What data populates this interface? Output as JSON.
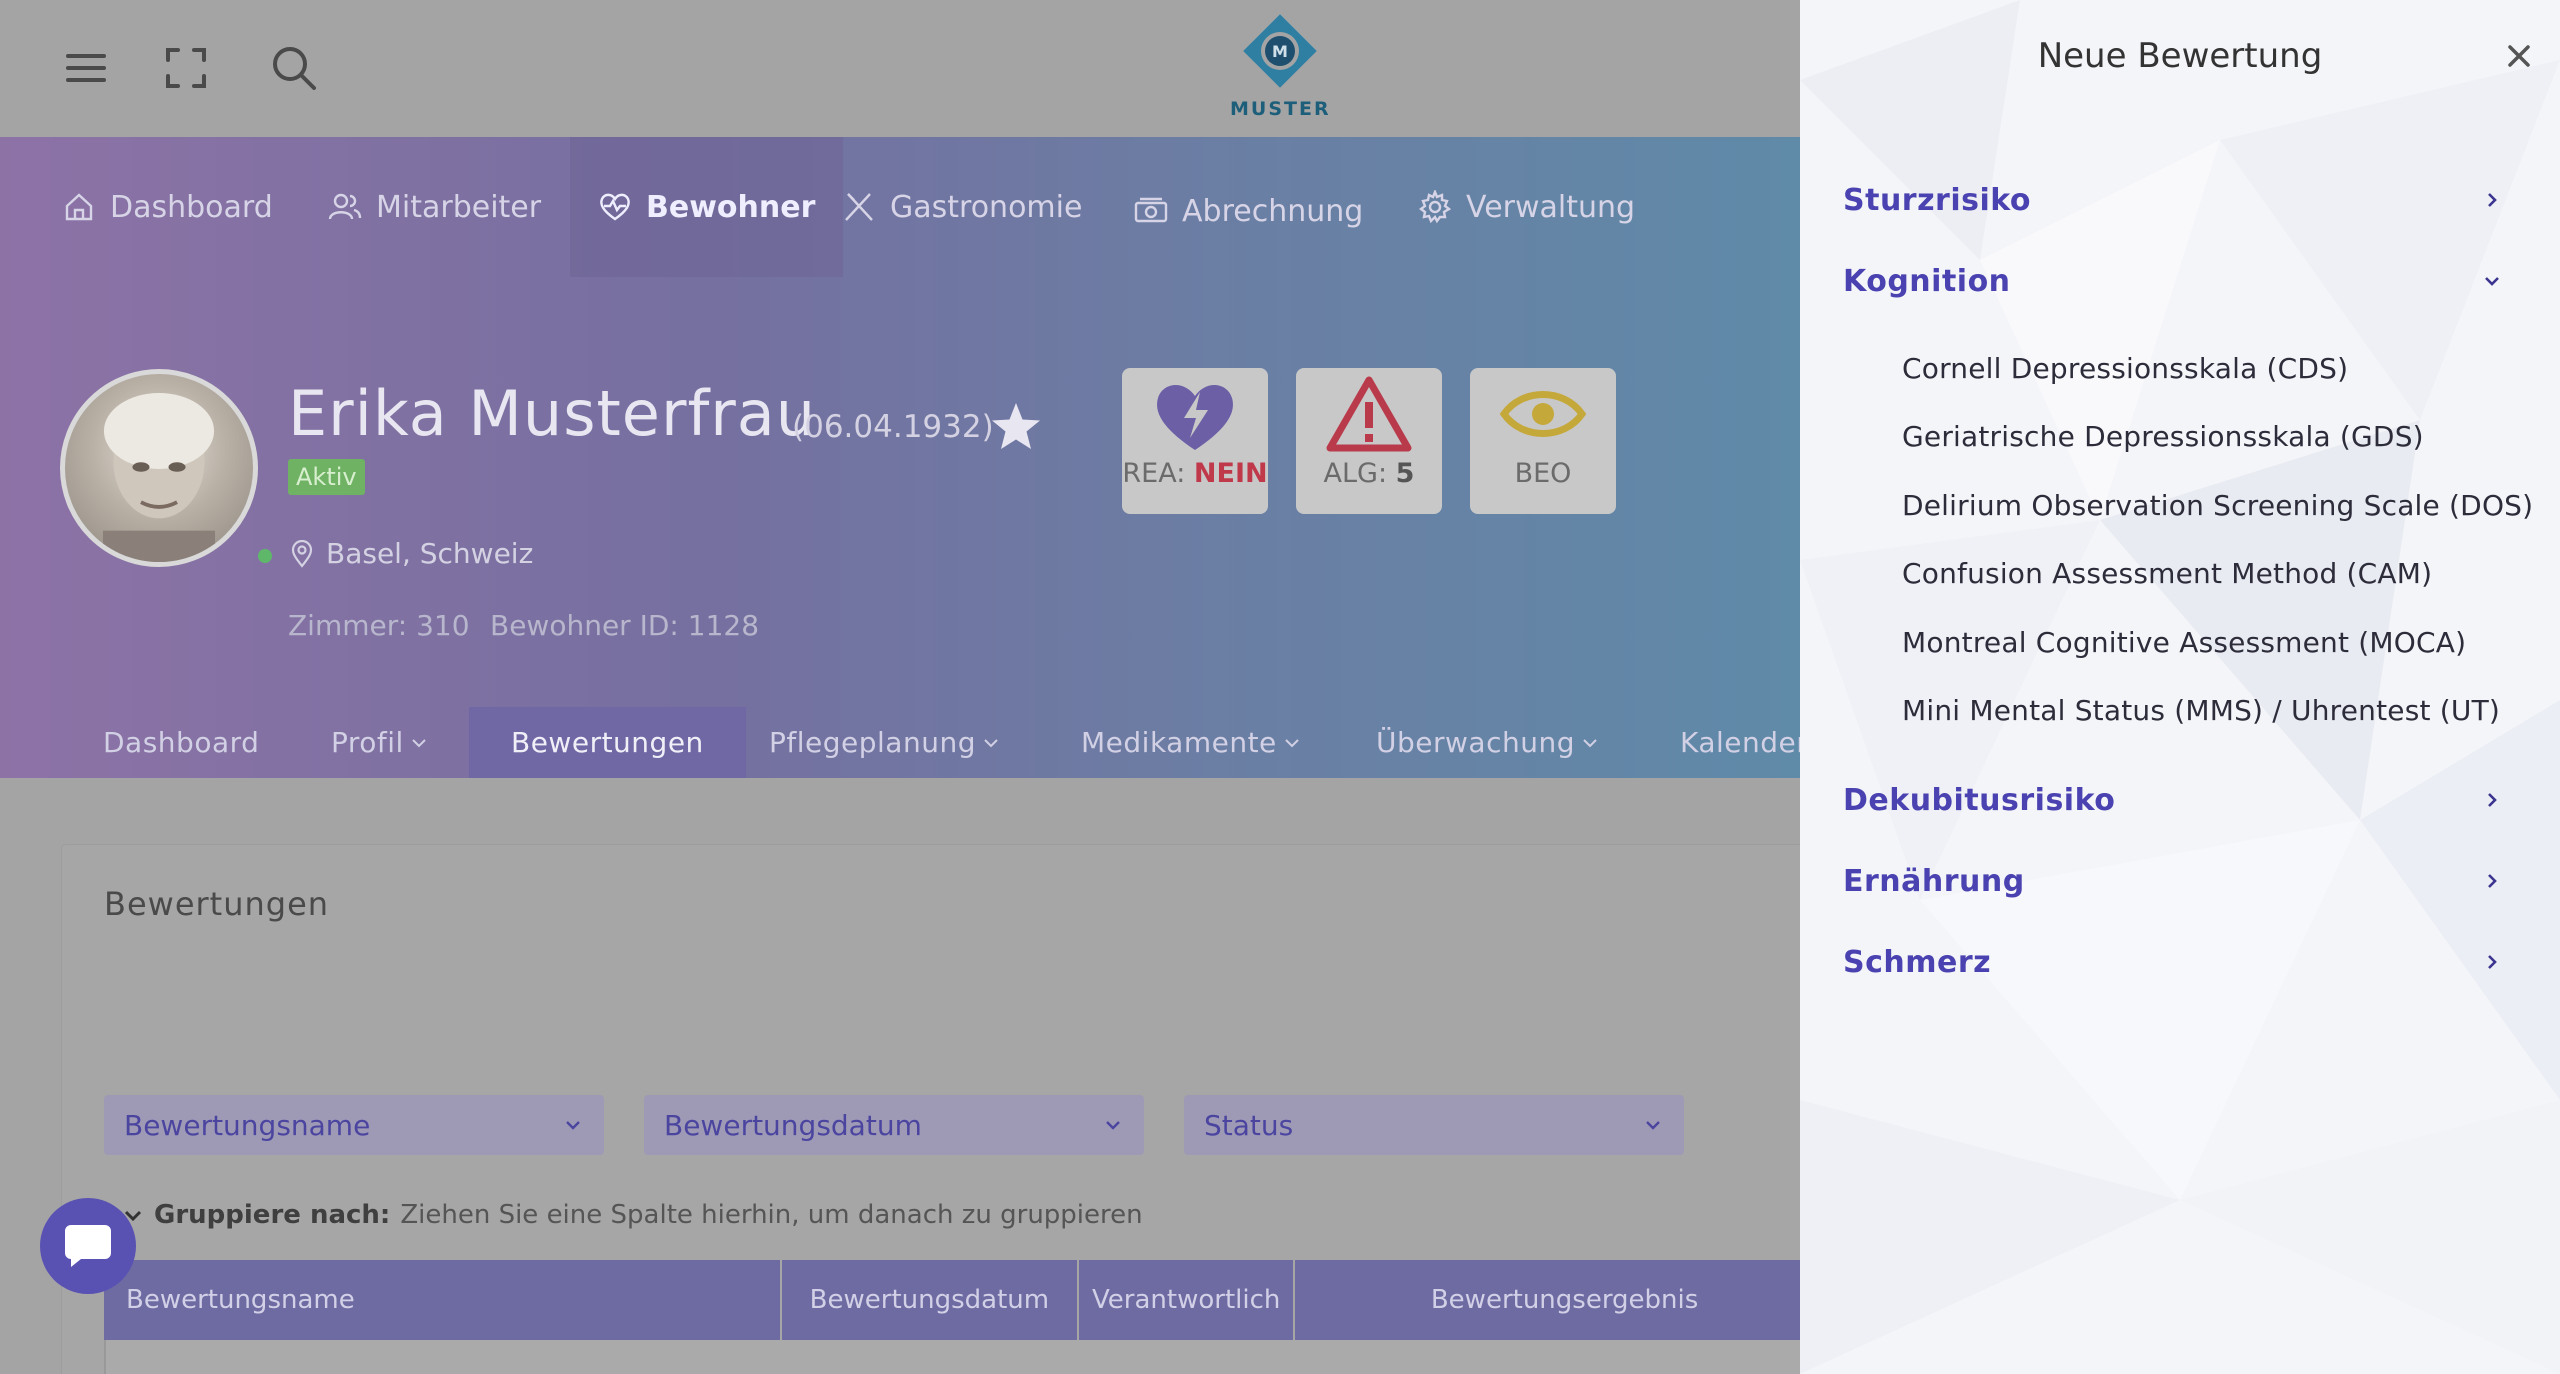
{
  "brand": {
    "logo_text": "MUSTER"
  },
  "nav": [
    {
      "label": "Dashboard",
      "icon": "home-icon"
    },
    {
      "label": "Mitarbeiter",
      "icon": "users-icon"
    },
    {
      "label": "Bewohner",
      "icon": "heart-pulse-icon",
      "active": true
    },
    {
      "label": "Gastronomie",
      "icon": "utensils-icon"
    },
    {
      "label": "Abrechnung",
      "icon": "money-icon"
    },
    {
      "label": "Verwaltung",
      "icon": "gear-icon"
    }
  ],
  "resident": {
    "name": "Erika Musterfrau",
    "dob": "(06.04.1932)",
    "status": "Aktiv",
    "location": "Basel, Schweiz",
    "room": "Zimmer: 310",
    "resident_id": "Bewohner ID: 1128"
  },
  "tiles": {
    "rea_label": "REA:",
    "rea_value": "NEIN",
    "alg_label": "ALG:",
    "alg_value": "5",
    "beo_label": "BEO"
  },
  "subnav": [
    {
      "label": "Dashboard"
    },
    {
      "label": "Profil"
    },
    {
      "label": "Bewertungen",
      "active": true
    },
    {
      "label": "Pflegeplanung"
    },
    {
      "label": "Medikamente"
    },
    {
      "label": "Überwachung"
    },
    {
      "label": "Kalender"
    }
  ],
  "content": {
    "title": "Bewertungen",
    "filters": [
      "Bewertungsname",
      "Bewertungsdatum",
      "Status"
    ],
    "group_by_label": "Gruppiere nach:",
    "group_by_hint": "Ziehen Sie eine Spalte hierhin, um danach zu gruppieren",
    "columns": [
      "Bewertungsname",
      "Bewertungsdatum",
      "Verantwortlich",
      "Bewertungsergebnis"
    ]
  },
  "drawer": {
    "title": "Neue Bewertung",
    "sections": [
      {
        "label": "Sturzrisiko",
        "expanded": false
      },
      {
        "label": "Kognition",
        "expanded": true,
        "items": [
          "Cornell Depressionsskala (CDS)",
          "Geriatrische Depressionsskala (GDS)",
          "Delirium Observation Screening Scale (DOS)",
          "Confusion Assessment Method (CAM)",
          "Montreal Cognitive Assessment (MOCA)",
          "Mini Mental Status (MMS) / Uhrentest (UT)"
        ]
      },
      {
        "label": "Dekubitusrisiko",
        "expanded": false
      },
      {
        "label": "Ernährung",
        "expanded": false
      },
      {
        "label": "Schmerz",
        "expanded": false
      }
    ]
  },
  "colors": {
    "accent": "#4a42b0",
    "header_start": "#8d72a6",
    "header_end": "#5f8aa8",
    "overlay": "#a4a4a4",
    "aktiv": "#6fb263",
    "alert_red": "#c0394b"
  }
}
